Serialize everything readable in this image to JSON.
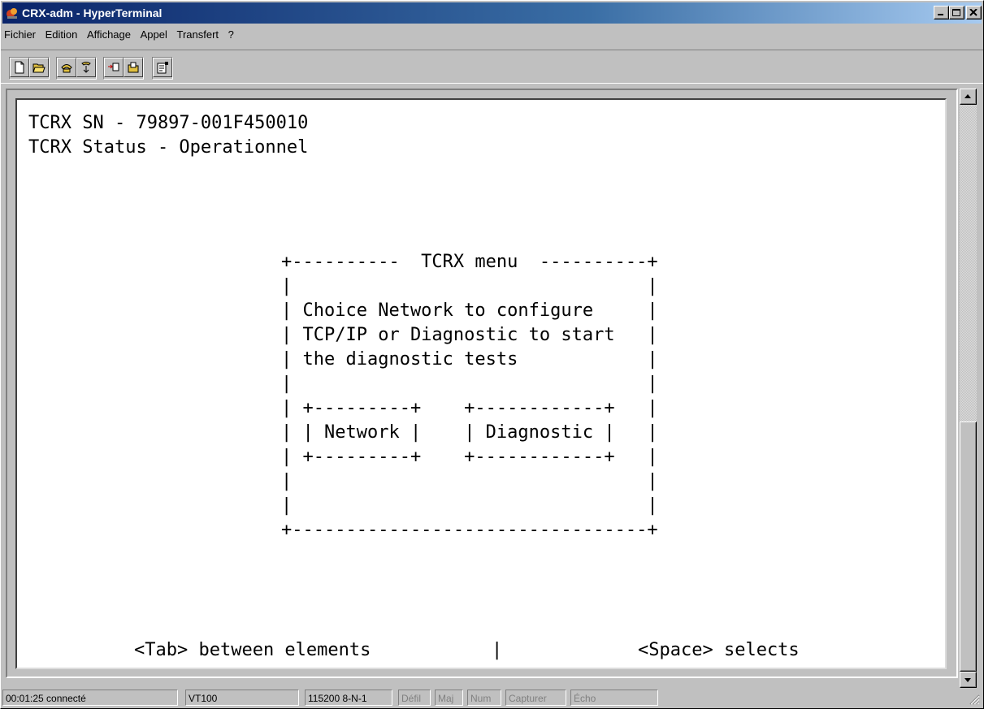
{
  "window": {
    "title": "CRX-adm - HyperTerminal"
  },
  "menu": [
    "Fichier",
    "Edition",
    "Affichage",
    "Appel",
    "Transfert",
    "?"
  ],
  "toolbar": {
    "groups": [
      [
        "new-document-icon",
        "open-folder-icon"
      ],
      [
        "call-phone-icon",
        "hangup-phone-icon"
      ],
      [
        "send-file-icon",
        "receive-file-icon"
      ],
      [
        "properties-icon"
      ]
    ]
  },
  "terminal": {
    "header_lines": [
      "TCRX SN - 79897-001F450010",
      "TCRX Status - Operationnel"
    ],
    "box": {
      "top": "+----------  TCRX menu  ----------+",
      "blank": "|                                 |",
      "text_lines": [
        "| Choice Network to configure     |",
        "| TCP/IP or Diagnostic to start   |",
        "| the diagnostic tests            |"
      ],
      "button_top": "| +---------+    +------------+   |",
      "button_row_left": "| ",
      "network_button": "| Network |",
      "button_gap": "    ",
      "diagnostic_button": "| Diagnostic |",
      "button_row_right": "   |",
      "button_bottom": "| +---------+    +------------+   |",
      "bottom": "+---------------------------------+"
    },
    "footer_left": "<Tab> between elements",
    "footer_sep": "|",
    "footer_right": "<Space> selects"
  },
  "status": {
    "time": "00:01:25 connecté",
    "emulation": "VT100",
    "port": "115200 8-N-1",
    "indicators": [
      "Défil",
      "Maj",
      "Num",
      "Capturer",
      "Écho"
    ]
  }
}
